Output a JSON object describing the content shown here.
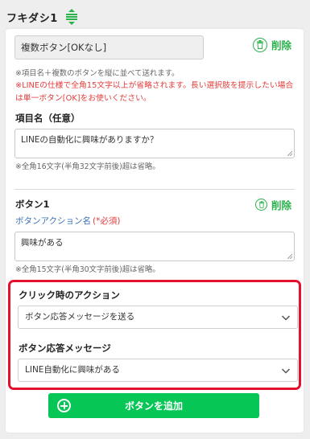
{
  "header": {
    "title": "フキダシ1"
  },
  "type_select": {
    "value": "複数ボタン[OKなし]"
  },
  "delete_label": "削除",
  "notes": {
    "info": "※項目名＋複数のボタンを縦に並べて送れます。",
    "warning": "※LINEの仕様で全角15文字以上が省略されます。長い選択肢を提示したい場合は単一ボタン[OK]をお使いください。"
  },
  "item": {
    "label": "項目名（任意）",
    "value": "LINEの自動化に興味がありますか？",
    "hint": "※全角16文字(半角32文字前後)超は省略。"
  },
  "button1": {
    "label": "ボタン1",
    "delete_label": "削除",
    "action_name_label": "ボタンアクション名",
    "required": "(*必須)",
    "action_name_value": "興味がある",
    "hint": "※全角15文字(半角30文字前後)超は省略。"
  },
  "click_action": {
    "label": "クリック時のアクション",
    "value": "ボタン応答メッセージを送る"
  },
  "response": {
    "label": "ボタン応答メッセージ",
    "value": "LINE自動化に興味がある"
  },
  "add_button": {
    "label": "ボタンを追加"
  },
  "colors": {
    "accent": "#06c755",
    "delete": "#2bb24c",
    "warning": "#e23b3b",
    "highlight": "#e3102e",
    "link": "#3a73b8"
  },
  "icons": {
    "drag": "drag-handle-icon",
    "delete": "trash-icon",
    "chevron": "chevron-down-icon",
    "add": "plus-circle-icon"
  }
}
